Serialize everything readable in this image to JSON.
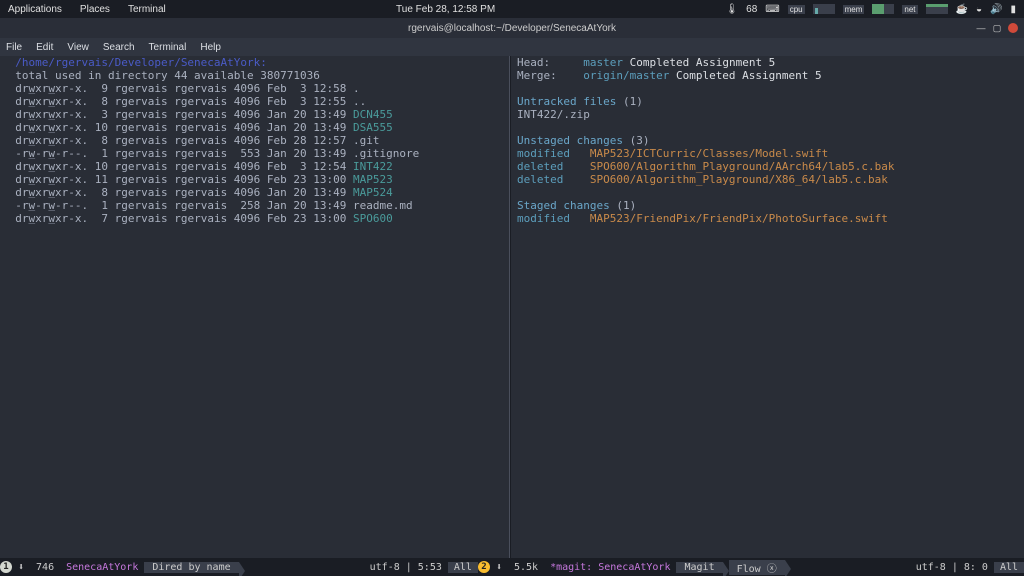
{
  "gnome": {
    "apps": "Applications",
    "places": "Places",
    "terminal": "Terminal",
    "clock": "Tue Feb 28, 12:58 PM",
    "temp": "68",
    "cpu": "cpu",
    "mem": "mem",
    "net": "net"
  },
  "window": {
    "title": "rgervais@localhost:~/Developer/SenecaAtYork"
  },
  "emacs_menu": [
    "File",
    "Edit",
    "View",
    "Search",
    "Terminal",
    "Help"
  ],
  "dired": {
    "path": "/home/rgervais/Developer/SenecaAtYork:",
    "total": "total used in directory 44 available 380771036",
    "rows": [
      {
        "perm": "drwxrwxr-x.",
        "n": "9",
        "u": "rgervais",
        "g": "rgervais",
        "size": "4096",
        "date": "Feb  3 12:58",
        "name": ".",
        "cls": ""
      },
      {
        "perm": "drwxrwxr-x.",
        "n": "8",
        "u": "rgervais",
        "g": "rgervais",
        "size": "4096",
        "date": "Feb  3 12:55",
        "name": "..",
        "cls": ""
      },
      {
        "perm": "drwxrwxr-x.",
        "n": "3",
        "u": "rgervais",
        "g": "rgervais",
        "size": "4096",
        "date": "Jan 20 13:49",
        "name": "DCN455",
        "cls": "c-teal"
      },
      {
        "perm": "drwxrwxr-x.",
        "n": "10",
        "u": "rgervais",
        "g": "rgervais",
        "size": "4096",
        "date": "Jan 20 13:49",
        "name": "DSA555",
        "cls": "c-teal"
      },
      {
        "perm": "drwxrwxr-x.",
        "n": "8",
        "u": "rgervais",
        "g": "rgervais",
        "size": "4096",
        "date": "Feb 28 12:57",
        "name": ".git",
        "cls": ""
      },
      {
        "perm": "-rw-rw-r--.",
        "n": "1",
        "u": "rgervais",
        "g": "rgervais",
        "size": "553",
        "date": "Jan 20 13:49",
        "name": ".gitignore",
        "cls": ""
      },
      {
        "perm": "drwxrwxr-x.",
        "n": "10",
        "u": "rgervais",
        "g": "rgervais",
        "size": "4096",
        "date": "Feb  3 12:54",
        "name": "INT422",
        "cls": "c-teal"
      },
      {
        "perm": "drwxrwxr-x.",
        "n": "11",
        "u": "rgervais",
        "g": "rgervais",
        "size": "4096",
        "date": "Feb 23 13:00",
        "name": "MAP523",
        "cls": "c-teal"
      },
      {
        "perm": "drwxrwxr-x.",
        "n": "8",
        "u": "rgervais",
        "g": "rgervais",
        "size": "4096",
        "date": "Jan 20 13:49",
        "name": "MAP524",
        "cls": "c-teal"
      },
      {
        "perm": "-rw-rw-r--.",
        "n": "1",
        "u": "rgervais",
        "g": "rgervais",
        "size": "258",
        "date": "Jan 20 13:49",
        "name": "readme.md",
        "cls": ""
      },
      {
        "perm": "drwxrwxr-x.",
        "n": "7",
        "u": "rgervais",
        "g": "rgervais",
        "size": "4096",
        "date": "Feb 23 13:00",
        "name": "SPO600",
        "cls": "c-teal"
      }
    ]
  },
  "magit": {
    "head_lbl": "Head:",
    "head_branch": "master",
    "head_msg": "Completed Assignment 5",
    "merge_lbl": "Merge:",
    "merge_branch": "origin/master",
    "merge_msg": "Completed Assignment 5",
    "untracked_hdr": "Untracked files",
    "untracked_cnt": "(1)",
    "untracked": [
      "INT422/.zip"
    ],
    "unstaged_hdr": "Unstaged changes",
    "unstaged_cnt": "(3)",
    "unstaged": [
      {
        "action": "modified",
        "path": "MAP523/ICTCurric/Classes/Model.swift"
      },
      {
        "action": "deleted",
        "path": "SPO600/Algorithm_Playground/AArch64/lab5.c.bak"
      },
      {
        "action": "deleted",
        "path": "SPO600/Algorithm_Playground/X86_64/lab5.c.bak"
      }
    ],
    "staged_hdr": "Staged changes",
    "staged_cnt": "(1)",
    "staged": [
      {
        "action": "modified",
        "path": "MAP523/FriendPix/FriendPix/PhotoSurface.swift"
      }
    ]
  },
  "modeline": {
    "left": {
      "num": "1",
      "sym": "⬇",
      "size": "746",
      "buf": "SenecaAtYork",
      "mode": "Dired by name",
      "enc": "utf-8",
      "pos": "5:53",
      "pct": "All"
    },
    "right": {
      "num": "2",
      "sym": "⬇",
      "size": "5.5k",
      "buf": "*magit: SenecaAtYork",
      "m1": "Magit",
      "m2": "Flow ⓧ",
      "enc": "utf-8",
      "pos": "8: 0",
      "pct": "All"
    }
  }
}
